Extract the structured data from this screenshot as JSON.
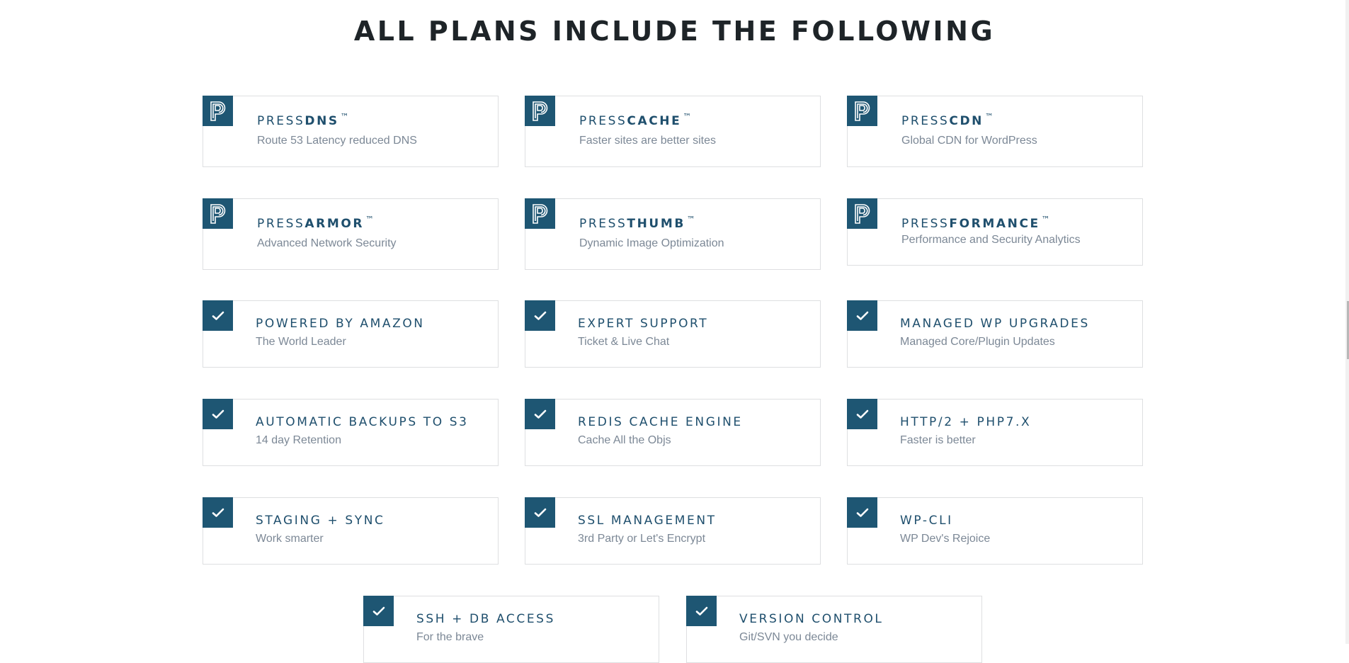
{
  "page_title": "ALL PLANS INCLUDE THE FOLLOWING",
  "accent_color": "#1e5673",
  "press_features": [
    {
      "prefix": "PRESS",
      "name": "DNS",
      "tm": "™",
      "subtitle": "Route 53 Latency reduced DNS",
      "icon": "press-p-icon"
    },
    {
      "prefix": "PRESS",
      "name": "CACHE",
      "tm": "™",
      "subtitle": "Faster sites are better sites",
      "icon": "press-p-icon"
    },
    {
      "prefix": "PRESS",
      "name": "CDN",
      "tm": "™",
      "subtitle": "Global CDN for WordPress",
      "icon": "press-p-icon"
    },
    {
      "prefix": "PRESS",
      "name": "ARMOR",
      "tm": "™",
      "subtitle": "Advanced Network Security",
      "icon": "press-p-icon"
    },
    {
      "prefix": "PRESS",
      "name": "THUMB",
      "tm": "™",
      "subtitle": "Dynamic Image Optimization",
      "icon": "press-p-icon"
    },
    {
      "prefix": "PRESS",
      "name": "FORMANCE",
      "tm": "™",
      "subtitle": "Performance and Security Analytics",
      "icon": "press-p-icon"
    }
  ],
  "check_features": [
    {
      "title": "POWERED BY AMAZON",
      "subtitle": "The World Leader",
      "icon": "checkmark-icon"
    },
    {
      "title": "EXPERT SUPPORT",
      "subtitle": "Ticket & Live Chat",
      "icon": "checkmark-icon"
    },
    {
      "title": "MANAGED WP UPGRADES",
      "subtitle": "Managed Core/Plugin Updates",
      "icon": "checkmark-icon"
    },
    {
      "title": "AUTOMATIC BACKUPS TO S3",
      "subtitle": "14 day Retention",
      "icon": "checkmark-icon"
    },
    {
      "title": "REDIS CACHE ENGINE",
      "subtitle": "Cache All the Objs",
      "icon": "checkmark-icon"
    },
    {
      "title": "HTTP/2 + PHP7.X",
      "subtitle": "Faster is better",
      "icon": "checkmark-icon"
    },
    {
      "title": "STAGING + SYNC",
      "subtitle": "Work smarter",
      "icon": "checkmark-icon"
    },
    {
      "title": "SSL MANAGEMENT",
      "subtitle": "3rd Party or Let's Encrypt",
      "icon": "checkmark-icon"
    },
    {
      "title": "WP-CLI",
      "subtitle": "WP Dev's Rejoice",
      "icon": "checkmark-icon"
    },
    {
      "title": "SSH + DB ACCESS",
      "subtitle": "For the brave",
      "icon": "checkmark-icon"
    },
    {
      "title": "VERSION CONTROL",
      "subtitle": "Git/SVN you decide",
      "icon": "checkmark-icon"
    }
  ]
}
